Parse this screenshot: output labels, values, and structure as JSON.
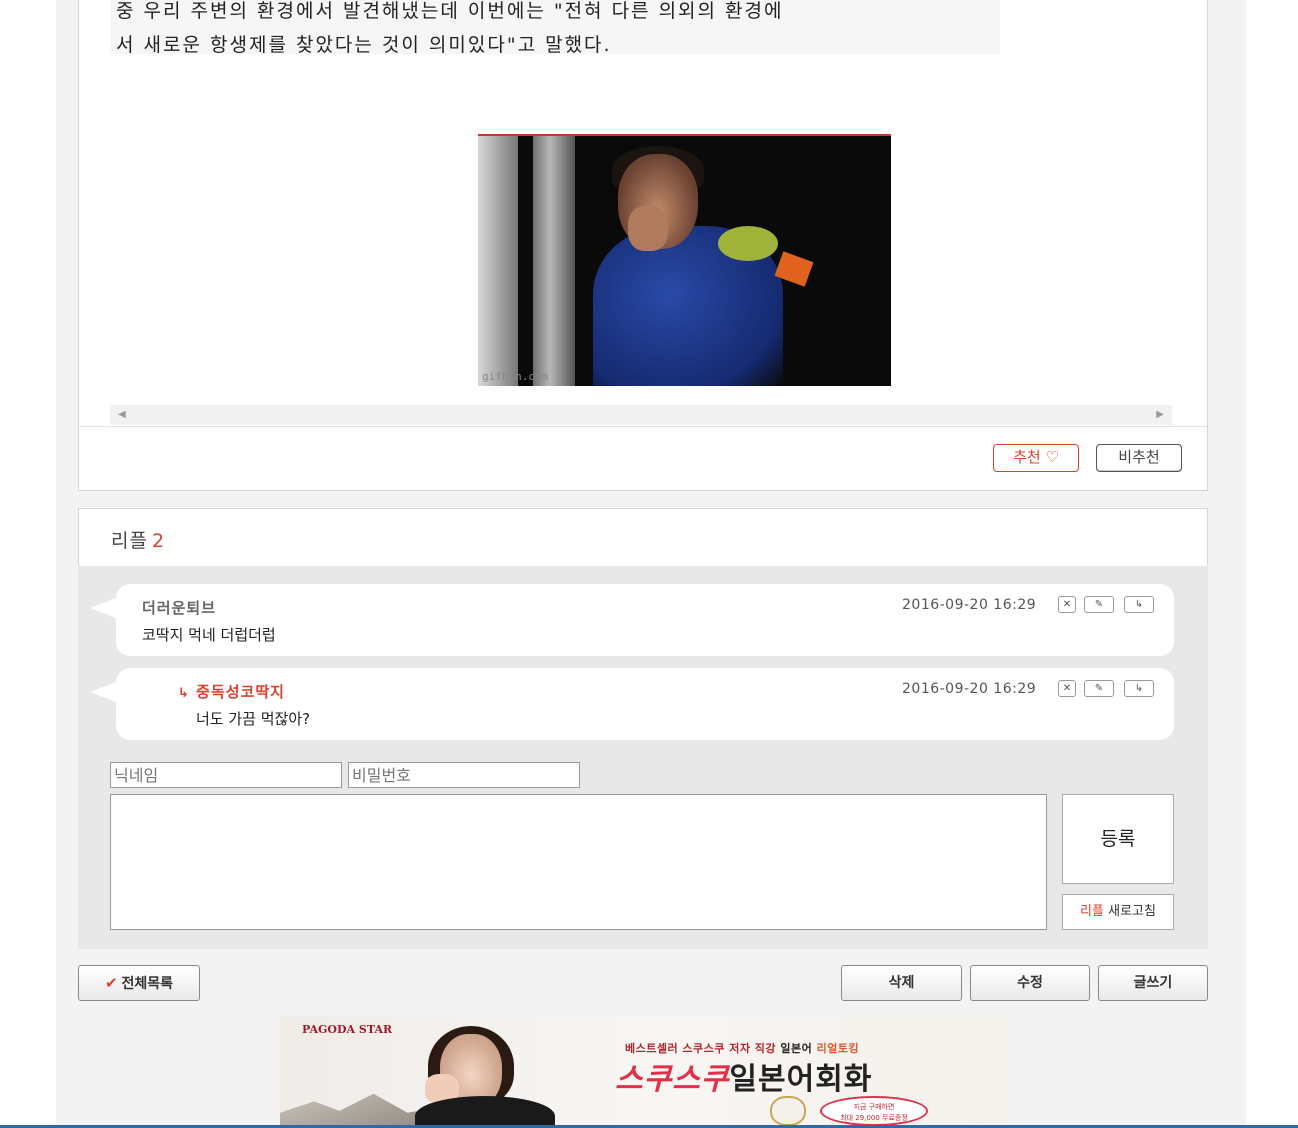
{
  "article": {
    "quote_line1": "중 우리 주변의 환경에서 발견해냈는데 이번에는 \"전혀 다른 의외의 환경에",
    "quote_line2": "서 새로운 항생제를 찾았다는 것이 의미있다\"고 말했다.",
    "gif_watermark": "gifbin.com"
  },
  "vote": {
    "recommend_label": "추천 ♡",
    "not_recommend_label": "비추천"
  },
  "replies": {
    "title": "리플",
    "count": "2",
    "items": [
      {
        "nick": "더러운퇴브",
        "text": "코딱지 먹네 더럽더럽",
        "date": "2016-09-20 16:29",
        "is_reply": false
      },
      {
        "nick": "중독성코딱지",
        "text": "너도 가끔 먹잖아?",
        "date": "2016-09-20 16:29",
        "is_reply": true,
        "reply_arrow": "↳"
      }
    ],
    "icons": {
      "delete": "✕",
      "edit": "✎",
      "reply": "↳"
    }
  },
  "form": {
    "nick_placeholder": "닉네임",
    "password_placeholder": "비밀번호",
    "submit_label": "등록",
    "refresh_prefix": "리플",
    "refresh_suffix": "새로고침"
  },
  "buttons": {
    "list_all": "전체목록",
    "list_check": "✔",
    "delete": "삭제",
    "edit": "수정",
    "write": "글쓰기"
  },
  "ad": {
    "brand": "PAGODA STAR",
    "tagline_part1": "베스트셀러 스쿠스쿠 저자 직강",
    "tagline_part2": "일본어",
    "tagline_part3": "리얼토킹",
    "headline_red": "스쿠스쿠",
    "headline_black": "일본어회화",
    "promo_line1": "지금 구매하면",
    "promo_line2": "최대 29,000 무료증정"
  },
  "colors": {
    "accent_red": "#d8422e",
    "panel_gray": "#e8e8e8",
    "bottom_bar": "#2f6aa8"
  }
}
